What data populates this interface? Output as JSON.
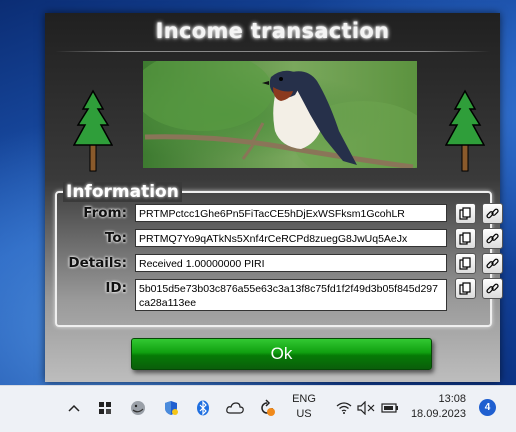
{
  "dialog": {
    "title": "Income transaction",
    "group_caption": "Information",
    "fields": {
      "from": {
        "label": "From:",
        "value": "PRTMPctcc1Ghe6Pn5FiTacCE5hDjExWSFksm1GcohLR"
      },
      "to": {
        "label": "To:",
        "value": "PRTMQ7Yo9qATkNs5Xnf4rCeRCPd8zuegG8JwUq5AeJx"
      },
      "details": {
        "label": "Details:",
        "value": "Received 1.00000000 PIRI"
      },
      "id": {
        "label": "ID:",
        "value": "5b015d5e73b03c876a55e63c3a13f8c75fd1f2f49d3b05f845d297ca28a113ee"
      }
    },
    "ok_label": "Ok",
    "icons": {
      "copy": "copy-icon",
      "link": "link-icon",
      "tree": "pine-tree-icon"
    },
    "colors": {
      "ok_button": "#10a010",
      "tree": "#2f9e3a"
    }
  },
  "taskbar": {
    "language_line1": "ENG",
    "language_line2": "US",
    "time": "13:08",
    "date": "18.09.2023",
    "notification_count": "4",
    "icons": [
      "chevron-up-icon",
      "app-icon",
      "bird-icon",
      "security-shield-icon",
      "bluetooth-icon",
      "cloud-icon",
      "update-icon",
      "wifi-icon",
      "volume-muted-icon",
      "battery-icon"
    ]
  }
}
